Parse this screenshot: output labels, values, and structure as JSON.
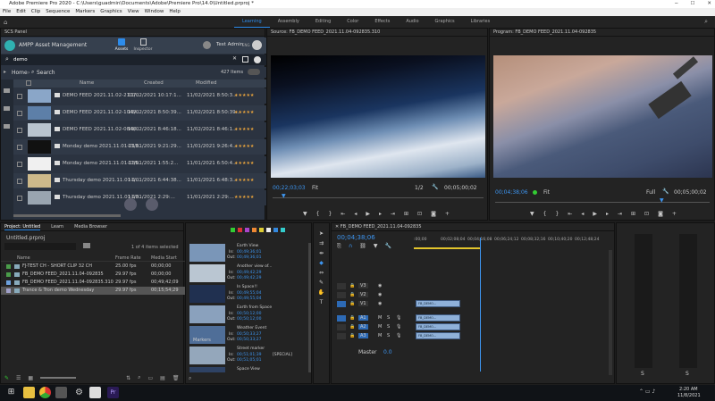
{
  "window": {
    "title": "Adobe Premiere Pro 2020 - C:\\Users\\guadmin\\Documents\\Adobe\\Premiere Pro\\14.0\\Untitled.prproj *"
  },
  "menu": [
    "File",
    "Edit",
    "Clip",
    "Sequence",
    "Markers",
    "Graphics",
    "View",
    "Window",
    "Help"
  ],
  "workspaces": [
    {
      "label": "Learning",
      "active": true
    },
    {
      "label": "Assembly",
      "active": false
    },
    {
      "label": "Editing",
      "active": false
    },
    {
      "label": "Color",
      "active": false
    },
    {
      "label": "Effects",
      "active": false
    },
    {
      "label": "Audio",
      "active": false
    },
    {
      "label": "Graphics",
      "active": false
    },
    {
      "label": "Libraries",
      "active": false
    }
  ],
  "scs_panel": {
    "header": "SCS Panel",
    "app_name": "AMPP Asset Management",
    "tab_assets": "Assets",
    "tab_inspector": "Inspector",
    "user": "Test Admin",
    "user_tag": "ENG",
    "search_value": "demo",
    "breadcrumb_home": "Home",
    "breadcrumb_search": "Search",
    "items_count": "427 Items",
    "columns": [
      "Name",
      "Created",
      "Modified"
    ],
    "rows": [
      {
        "name": "DEMO FEED 2021.11.02-2117...",
        "created": "11/02/2021 10:17:1...",
        "modified": "11/02/2021 8:50:3..."
      },
      {
        "name": "DEMO FEED 2021.11.02-1049...",
        "created": "11/02/2021 8:50:39...",
        "modified": "11/02/2021 8:50:39..."
      },
      {
        "name": "DEMO FEED 2021.11.02-0846...",
        "created": "11/02/2021 8:46:18...",
        "modified": "11/02/2021 8:46:1..."
      },
      {
        "name": "Monday demo 2021.11.01-213...",
        "created": "11/01/2021 9:21:29...",
        "modified": "11/01/2021 9:26:4..."
      },
      {
        "name": "Monday demo 2021.11.01-135...",
        "created": "11/01/2021 1:55:2...",
        "modified": "11/01/2021 6:50:4..."
      },
      {
        "name": "Thursday demo 2021.11.01-1...",
        "created": "11/01/2021 6:44:38...",
        "modified": "11/01/2021 6:48:3..."
      },
      {
        "name": "Thursday demo 2021.11.01-13...",
        "created": "11/01/2021 2:29:...",
        "modified": "11/01/2021 2:29:..."
      }
    ]
  },
  "source_monitor": {
    "header": "Source: FB_DEMO FEED_2021.11.04-092835.310",
    "timecode_in": "00;22;03;03",
    "fit": "Fit",
    "fraction": "1/2",
    "duration": "00;05;00;02"
  },
  "program_monitor": {
    "header": "Program: FB_DEMO FEED_2021.11.04-092835",
    "timecode": "00;04;38;06",
    "fit": "Fit",
    "quality": "Full",
    "duration": "00;05;00;02"
  },
  "project_panel": {
    "tabs": [
      "Project: Untitled",
      "Learn",
      "Media Browser"
    ],
    "file": "Untitled.prproj",
    "selected_count": "1 of 4 items selected",
    "columns": [
      "Name",
      "Frame Rate",
      "Media Start"
    ],
    "rows": [
      {
        "name": "FJ-TEST CH - SHORT CLIP 32 CH",
        "fps": "25.00 fps",
        "start": "00;00;00"
      },
      {
        "name": "FB_DEMO FEED_2021.11.04-092835",
        "fps": "29.97 fps",
        "start": "00;00;00"
      },
      {
        "name": "FB_DEMO FEED_2021.11.04-092835.310",
        "fps": "29.97 fps",
        "start": "00;49;42;09"
      },
      {
        "name": "Trance & Tron demo Wednesday",
        "fps": "29.97 fps",
        "start": "00;15;54;29"
      }
    ]
  },
  "markers_panel": {
    "header": "Markers",
    "items": [
      {
        "title": "Earth View",
        "in": "00;49;36;01",
        "out": "00;49;36;01",
        "extra": ""
      },
      {
        "title": "Another view of...",
        "in": "00;49;42;29",
        "out": "00;49;42;29",
        "extra": ""
      },
      {
        "title": "In Space!!",
        "in": "00;49;55;04",
        "out": "00;49;55;04",
        "extra": ""
      },
      {
        "title": "Earth from Space",
        "in": "00;50;12;00",
        "out": "00;50;12;00",
        "extra": ""
      },
      {
        "title": "Weather Event",
        "in": "00;50;33;27",
        "out": "00;50;33;27",
        "extra": ""
      },
      {
        "title": "Street marker",
        "in": "00;51;01;39",
        "out": "00;51;05;01",
        "extra": "[SPECIAL]"
      },
      {
        "title": "Space View",
        "in": "00;52;24;22",
        "out": "00;52;24;22",
        "extra": ""
      }
    ]
  },
  "timeline": {
    "header": "FB_DEMO FEED_2021.11.04-092835",
    "timecode": "00;04;38;06",
    "ruler": [
      ":00;00",
      "00;02;08;04",
      "00;04;16;08",
      "00;06;24;12",
      "00;08;32;16",
      "00;10;40;20",
      "00;12;48;24"
    ],
    "video_tracks": [
      "V3",
      "V2",
      "V1"
    ],
    "audio_tracks": [
      "A1",
      "A2",
      "A3"
    ],
    "master": "Master",
    "master_val": "0.0",
    "clip_label": "FB_DEMO..."
  },
  "audio_meter": {
    "labels": [
      "S",
      "S"
    ]
  },
  "taskbar": {
    "time": "2:20 AM",
    "date": "11/8/2021"
  }
}
